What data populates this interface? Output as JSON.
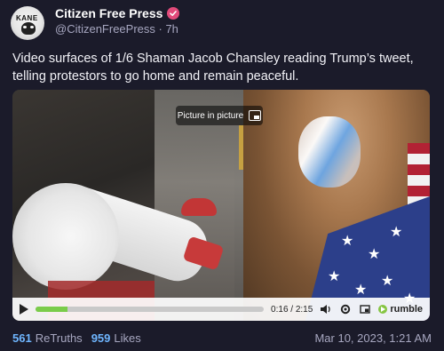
{
  "post": {
    "author_name": "Citizen Free Press",
    "handle_line": "@CitizenFreePress · 7h",
    "avatar_text": "KANE",
    "text": "Video surfaces  of 1/6 Shaman Jacob Chansley reading Trump’s tweet, telling protestors to go home and remain peaceful."
  },
  "video": {
    "pip_label": "Picture in picture",
    "time": "0:16 / 2:15",
    "progress_fraction": 0.14,
    "brand": "rumble"
  },
  "stats": {
    "retruths_count": "561",
    "retruths_label": "ReTruths",
    "likes_count": "959",
    "likes_label": "Likes"
  },
  "date": "Mar 10, 2023, 1:21 AM",
  "colors": {
    "background": "#1b1b2a",
    "accent_blue": "#6fb6ff",
    "verified_pink": "#e14a7a",
    "rumble_green": "#86c543"
  },
  "icons": {
    "verified": "verified-badge-icon",
    "play": "play-icon",
    "volume": "volume-icon",
    "settings": "settings-icon",
    "fullscreen": "fullscreen-icon",
    "pip": "picture-in-picture-icon"
  }
}
